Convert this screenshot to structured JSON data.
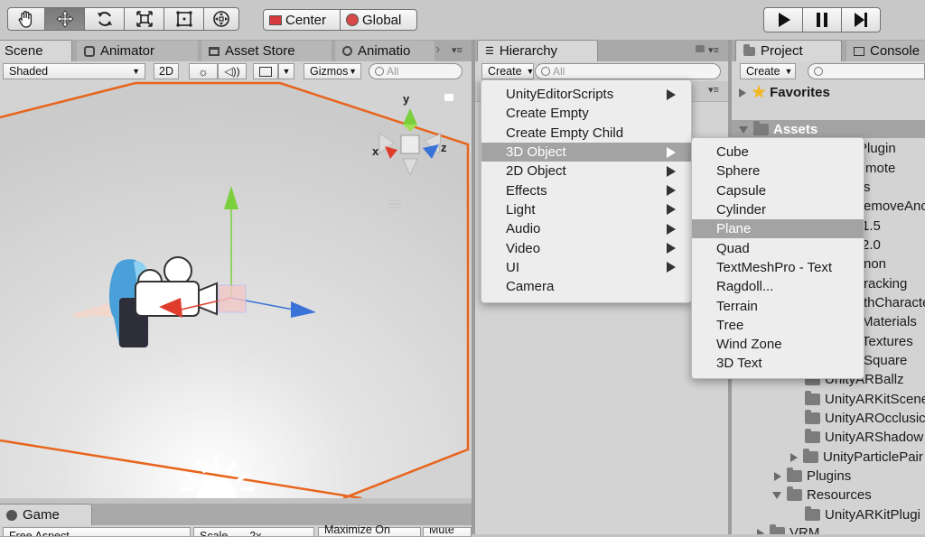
{
  "toolbar": {
    "tools": [
      "hand-tool",
      "move-tool",
      "rotate-tool",
      "scale-tool",
      "rect-tool",
      "transform-tool"
    ],
    "pivot_label": "Center",
    "space_label": "Global"
  },
  "scene_panel": {
    "tabs": [
      "Scene",
      "Animator",
      "Asset Store",
      "Animatio"
    ],
    "shading": "Shaded",
    "mode_2d": "2D",
    "gizmos": "Gizmos",
    "search_placeholder": "All",
    "axis_y": "y",
    "axis_x": "x",
    "axis_z": "z"
  },
  "game_panel": {
    "tab": "Game",
    "aspect": "Free Aspect",
    "scale_label": "Scale",
    "scale_value": "2x",
    "maximize": "Maximize On Play",
    "mute": "Mute Au"
  },
  "hierarchy": {
    "tab": "Hierarchy",
    "create": "Create",
    "search_placeholder": "All"
  },
  "create_menu": {
    "items": [
      {
        "label": "UnityEditorScripts",
        "submenu": true
      },
      {
        "label": "Create Empty",
        "submenu": false
      },
      {
        "label": "Create Empty Child",
        "submenu": false
      },
      {
        "label": "3D Object",
        "submenu": true,
        "highlighted": true
      },
      {
        "label": "2D Object",
        "submenu": true
      },
      {
        "label": "Effects",
        "submenu": true
      },
      {
        "label": "Light",
        "submenu": true
      },
      {
        "label": "Audio",
        "submenu": true
      },
      {
        "label": "Video",
        "submenu": true
      },
      {
        "label": "UI",
        "submenu": true
      },
      {
        "label": "Camera",
        "submenu": false
      }
    ]
  },
  "submenu_3d": {
    "items": [
      "Cube",
      "Sphere",
      "Capsule",
      "Cylinder",
      "Plane",
      "Quad",
      "TextMeshPro - Text",
      "Ragdoll...",
      "Terrain",
      "Tree",
      "Wind Zone",
      "3D Text"
    ],
    "highlighted": "Plane"
  },
  "project": {
    "tab": "Project",
    "console_tab": "Console",
    "create": "Create",
    "favorites": "Favorites",
    "assets": "Assets",
    "hidden_rows": [
      "Plugin",
      "mote",
      "s",
      "emoveAnc",
      "1.5",
      "2.0",
      "non",
      "racking",
      "thCharacte",
      "Materials",
      "Textures",
      "Square"
    ],
    "rows": [
      {
        "label": "UnityARBallz",
        "arrow": "none"
      },
      {
        "label": "UnityARKitScene",
        "arrow": "none"
      },
      {
        "label": "UnityAROcclusic",
        "arrow": "none"
      },
      {
        "label": "UnityARShadow",
        "arrow": "none"
      },
      {
        "label": "UnityParticlePair",
        "arrow": "right"
      },
      {
        "label": "Plugins",
        "arrow": "right"
      },
      {
        "label": "Resources",
        "arrow": "down"
      },
      {
        "label": "UnityARKitPlugi",
        "arrow": "none"
      },
      {
        "label": "VRM",
        "arrow": "right"
      }
    ]
  },
  "colors": {
    "plane_outline": "#e8641c",
    "axis_y": "#7bcf3c",
    "axis_x": "#e03c2c",
    "axis_z": "#3a73d8",
    "menu_highlight": "#a3a3a3"
  }
}
